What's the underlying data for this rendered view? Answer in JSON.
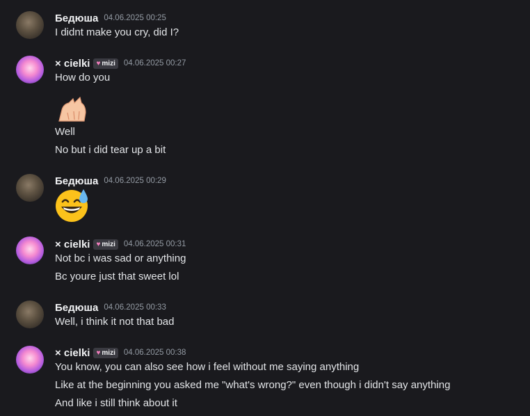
{
  "users": {
    "bedyusha": {
      "name": "Бедюша"
    },
    "cielki": {
      "name": "× cielki",
      "tag": "mizi"
    }
  },
  "messages": [
    {
      "author": "Бедюша",
      "timestamp": "04.06.2025 00:25",
      "lines": [
        "I didnt make you cry, did I?"
      ]
    },
    {
      "author": "× cielki",
      "tag": "mizi",
      "timestamp": "04.06.2025 00:27",
      "lines": [
        "How do you",
        "Well",
        "No but i did tear up a bit"
      ],
      "attachments": [
        "paw-emoji"
      ]
    },
    {
      "author": "Бедюша",
      "timestamp": "04.06.2025 00:29",
      "lines": [],
      "attachments": [
        "grinning-sweat-emoji"
      ]
    },
    {
      "author": "× cielki",
      "tag": "mizi",
      "timestamp": "04.06.2025 00:31",
      "lines": [
        "Not bc i was sad or anything",
        "Bc youre just that sweet lol"
      ]
    },
    {
      "author": "Бедюша",
      "timestamp": "04.06.2025 00:33",
      "lines": [
        "Well, i think it not that bad"
      ]
    },
    {
      "author": "× cielki",
      "tag": "mizi",
      "timestamp": "04.06.2025 00:38",
      "lines": [
        "You know,  you can also see how i feel without me saying anything",
        "Like at the beginning you asked me \"what's wrong?\" even though i didn't say anything",
        "And like i still think about it"
      ]
    }
  ],
  "colors": {
    "background": "#1a1a1e",
    "username": "#f2f3f5",
    "timestamp": "#949ba4",
    "text": "#e3e5e8",
    "tag_heart": "#f47fbe"
  }
}
